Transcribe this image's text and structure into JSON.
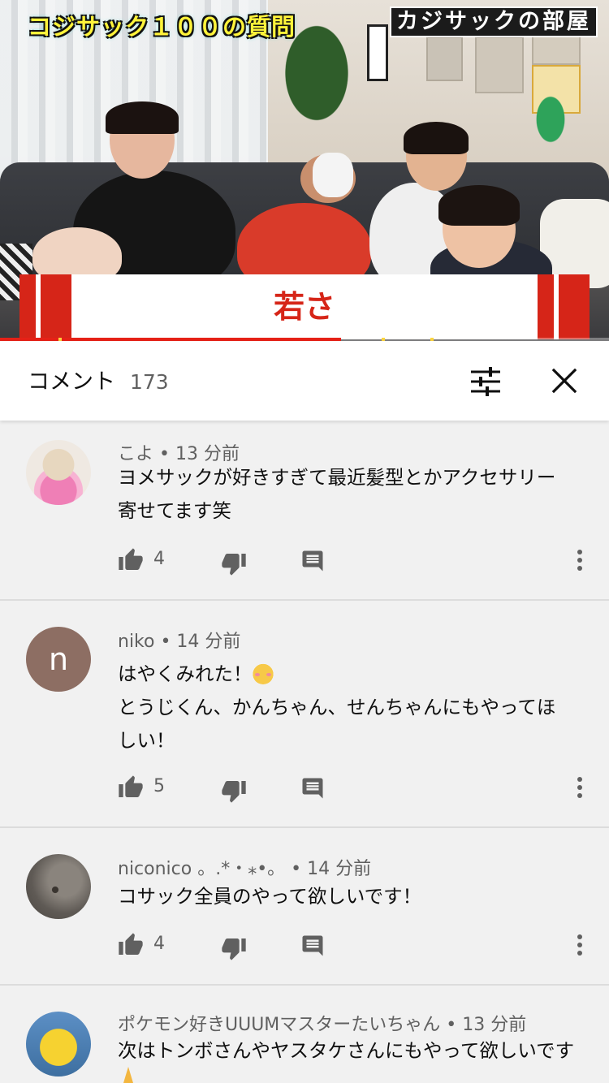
{
  "video": {
    "title_left": "コジサック１００の質問",
    "title_right": "カジサックの部屋",
    "caption": "若さ",
    "progress": 0.56
  },
  "comments_header": {
    "title": "コメント",
    "count": "173",
    "filter_icon": "sort-filter-icon",
    "close_icon": "close-icon"
  },
  "comments": [
    {
      "avatar": "knitted-bear-avatar",
      "meta": "こよ • 13 分前",
      "lines": [
        "ヨメサックが好きすぎて最近髪型とかアクセサリー",
        "寄せてます笑"
      ],
      "likes": "4"
    },
    {
      "avatar": "letter-n-avatar",
      "avatar_letter": "n",
      "avatar_color": "#8d6e63",
      "meta": "niko • 14 分前",
      "lines": [
        "はやくみれた！",
        "とうじくん、かんちゃん、せんちゃんにもやってほ",
        "しい！"
      ],
      "likes": "5"
    },
    {
      "avatar": "photo-avatar",
      "meta": "niconico 。.*・⁎•。 • 14 分前",
      "lines": [
        "コサック全員のやって欲しいです！"
      ],
      "likes": "4"
    },
    {
      "avatar": "pikachu-avatar",
      "meta": "ポケモン好きUUUMマスターたいちゃん • 13 分前",
      "lines": [
        "次はトンボさんやヤスタケさんにもやって欲しいです"
      ]
    }
  ],
  "colors": {
    "accent_red": "#d62518",
    "text_primary": "#0f0f0f",
    "text_secondary": "#606060",
    "background": "#f1f1f1"
  }
}
